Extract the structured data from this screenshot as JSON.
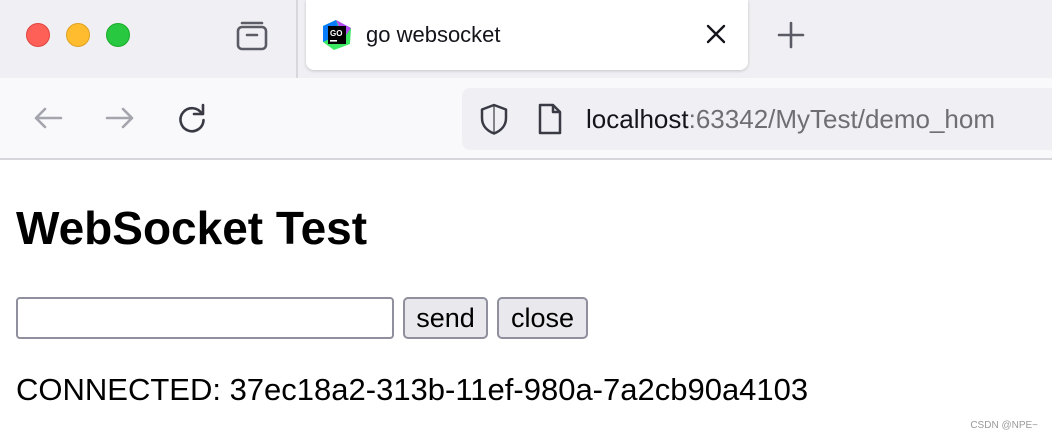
{
  "browser": {
    "tab": {
      "title": "go websocket",
      "favicon": "goland-icon"
    },
    "url": {
      "host": "localhost",
      "rest": ":63342/MyTest/demo_hom"
    },
    "icons": [
      "tabs-icon",
      "close-icon",
      "plus-icon",
      "back-arrow-icon",
      "forward-arrow-icon",
      "reload-icon",
      "shield-icon",
      "page-icon"
    ]
  },
  "page": {
    "title": "WebSocket Test",
    "input": {
      "value": "",
      "placeholder": ""
    },
    "send_label": "send",
    "close_label": "close",
    "status": "CONNECTED: 37ec18a2-313b-11ef-980a-7a2cb90a4103"
  },
  "watermark": "CSDN @NPE~"
}
